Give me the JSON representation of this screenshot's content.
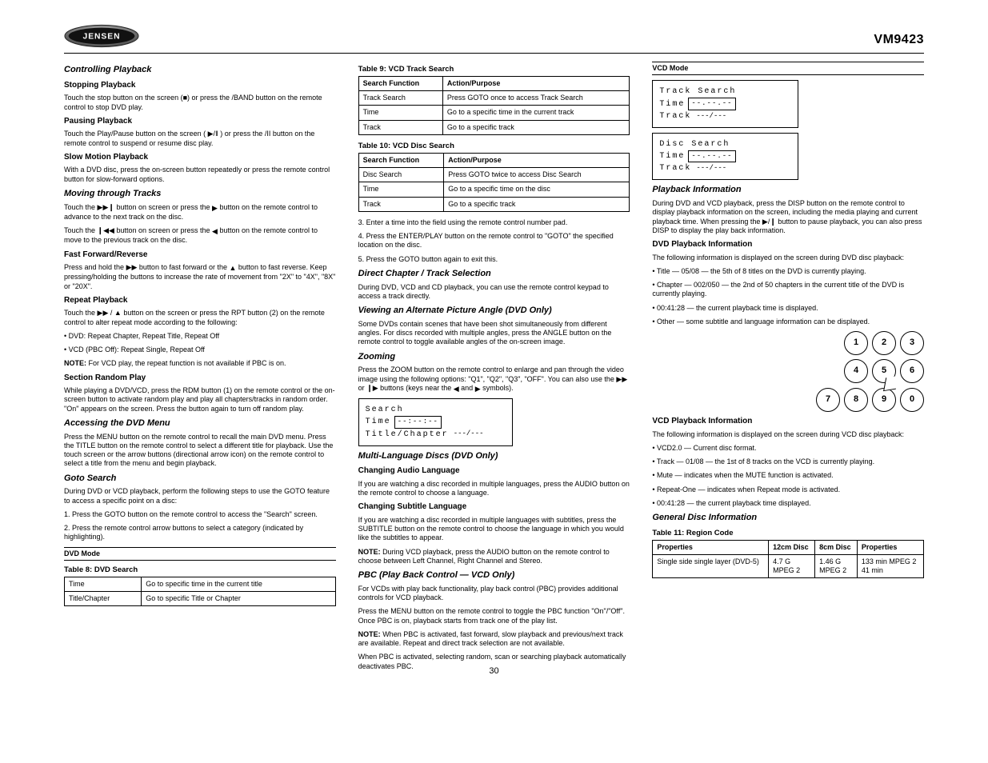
{
  "header": {
    "brand": "JENSEN",
    "model": "VM9423"
  },
  "col1": {
    "h_controlling": "Controlling Playback",
    "h_stopping": "Stopping Playback",
    "p_stopping": "Touch the stop button on the screen (■) or press the /BAND button on the remote control to stop DVD play.",
    "h_pausing": "Pausing Playback",
    "p_pausing_1": "Touch the Play/Pause button on the screen (",
    "p_pausing_2": ") or press the /II button on the remote control to suspend or resume disc play.",
    "h_slow": "Slow Motion Playback",
    "p_slow": "With a DVD disc, press the on-screen button repeatedly or press the remote control button for slow-forward options.",
    "h_moving": "Moving through Tracks",
    "p_moving_1a": "Touch the ",
    "p_moving_1b": " button on screen or press the ",
    "p_moving_1c": " button on the remote control to advance to the next track on the disc.",
    "p_moving_2a": "Touch the ",
    "p_moving_2b": " button on screen or press the ",
    "p_moving_2c": " button on the remote control to move to the previous track on the disc.",
    "h_ffrw": "Fast Forward/Reverse",
    "p_ffrw_a": "Press and hold the ",
    "p_ffrw_b": " button to fast forward or the ",
    "p_ffrw_c": " button to fast reverse. Keep pressing/holding the buttons to increase the rate of movement from \"2X\" to \"4X\", \"8X\" or \"20X\".",
    "h_repeat": "Repeat Playback",
    "p_repeat_a": "Touch the ",
    "p_repeat_b": "/",
    "p_repeat_c": " button on the screen or press the RPT button (2) on the remote control to alter repeat mode according to the following:",
    "list_dvd": "DVD: Repeat Chapter, Repeat Title, Repeat Off",
    "list_vcd": "VCD (PBC Off): Repeat Single, Repeat Off",
    "note_label": "NOTE:",
    "note_text": " For VCD play, the repeat function is not available if PBC is on.",
    "h_random": "Section Random Play",
    "p_random": "While playing a DVD/VCD, press the RDM button (1) on the remote control or the on-screen button to activate random play and play all chapters/tracks in random order. \"On\" appears on the screen. Press the button again to turn off random play.",
    "h_access": "Accessing the DVD Menu",
    "p_access": "Press the MENU button on the remote control to recall the main DVD menu. Press the TITLE button on the remote control to select a different title for playback. Use the touch screen or the arrow buttons (directional arrow icon) on the remote control to select a title from the menu and begin playback.",
    "h_goto": "Goto Search",
    "p_goto": "During DVD or VCD playback, perform the following steps to use the GOTO feature to access a specific point on a disc:",
    "step1": "1. Press the GOTO button on the remote control to access the \"Search\" screen.",
    "step2": "2. Press the remote control arrow buttons to select a category (indicated by highlighting).",
    "lbl_dvd_mode": "DVD Mode",
    "tbl1": {
      "title": "Table 8: DVD Search",
      "rows": [
        [
          "Time",
          "Go to specific time in the current title"
        ],
        [
          "Title/Chapter",
          "Go to specific Title or Chapter"
        ]
      ]
    }
  },
  "col2": {
    "tbl_vcd_track": {
      "title": "Table 9: VCD Track Search",
      "headers": [
        "Search Function",
        "Action/Purpose"
      ],
      "rows": [
        [
          "Track Search",
          "Press GOTO once to access Track Search"
        ],
        [
          "Time",
          "Go to a specific time in the current track"
        ],
        [
          "Track",
          "Go to a specific track"
        ]
      ]
    },
    "tbl_vcd_disc": {
      "title": "Table 10: VCD Disc Search",
      "headers": [
        "Search Function",
        "Action/Purpose"
      ],
      "rows": [
        [
          "Disc Search",
          "Press GOTO twice to access Disc Search"
        ],
        [
          "Time",
          "Go to a specific time on the disc"
        ],
        [
          "Track",
          "Go to a specific track"
        ]
      ]
    },
    "step3": "3. Enter a time into the field using the remote control number pad.",
    "step4": "4. Press the ENTER/PLAY button on the remote control to \"GOTO\" the specified location on the disc.",
    "step5": "5. Press the GOTO button again to exit this.",
    "h_direct": "Direct Chapter / Track Selection",
    "p_direct": "During DVD, VCD and CD playback, you can use the remote control keypad to access a track directly.",
    "h_angle": "Viewing an Alternate Picture Angle (DVD Only)",
    "p_angle1": "Some DVDs contain scenes that have been shot simultaneously from different angles. For discs recorded with multiple angles, press the ANGLE button on the remote control to toggle available angles of the on-screen image.",
    "h_zoom": "Zooming",
    "p_zoom_a": "Press the ZOOM button on the remote control to enlarge and pan through the video image using the following options: \"Q1\", \"Q2\", \"Q3\", \"OFF\". You can also use the ",
    "p_zoom_b": " or ",
    "p_zoom_c": " buttons (keys near the ",
    "p_zoom_d": " and ",
    "p_zoom_e": " symbols).",
    "h_multi": "Multi-Language Discs (DVD Only)",
    "h_audio": "Changing Audio Language",
    "p_audio": "If you are watching a disc recorded in multiple languages, press the AUDIO button on the remote control to choose a language.",
    "h_subtitle": "Changing Subtitle Language",
    "p_subtitle": "If you are watching a disc recorded in multiple languages with subtitles, press the SUBTITLE button on the remote control to choose the language in which you would like the subtitles to appear.",
    "note_label": "NOTE:",
    "note_text": " During VCD playback, press the AUDIO button on the remote control to choose between Left Channel, Right Channel and Stereo.",
    "h_pbc": "PBC (Play Back Control — VCD Only)",
    "p_pbc_intro": "For VCDs with play back functionality, play back control (PBC) provides additional controls for VCD playback.",
    "p_pbc_toggle": "Press the MENU button on the remote control to toggle the PBC function \"On\"/\"Off\". Once PBC is on, playback starts from track one of the play list.",
    "p_pbc_note_label": "NOTE:",
    "p_pbc_note": " When PBC is activated, fast forward, slow playback and previous/next track are available. Repeat and direct track selection are not available.",
    "p_pbc_rdm": "When PBC is activated, selecting random, scan or searching playback automatically deactivates PBC.",
    "h_osd_search": "Search",
    "osd_search": {
      "l1": "Search",
      "l2_label": "Time",
      "l2_field": "--:--:--",
      "l3_label": "Title/Chapter",
      "l3_dash": "---/---"
    }
  },
  "col3": {
    "lbl_vcd_mode": "VCD Mode",
    "osd_track": {
      "title": "Track Search",
      "time_label": "Time",
      "time_field": "--.--.--",
      "track_label": "Track",
      "track_dash": "---/---"
    },
    "osd_disc": {
      "title": "Disc Search",
      "time_label": "Time",
      "time_field": "--.--.--",
      "track_label": "Track",
      "track_dash": "---/---"
    },
    "h_disp": "Playback Information",
    "p_disp_a": "During DVD and VCD playback, press the DISP button on the remote control to display playback information on the screen, including the media playing and current playback time. When pressing the ",
    "p_disp_b": " button to pause playback, you can also press DISP to display the play back information.",
    "h_dvdinfo": "DVD Playback Information",
    "p_dvdinfo_intro": "The following information is displayed on the screen during DVD disc playback:",
    "dvd_items": [
      "Title — 05/08 — the 5th of 8 titles on the DVD is currently playing.",
      "Chapter — 002/050 — the 2nd of 50 chapters in the current title of the DVD is currently playing.",
      "00:41:28 — the current playback time is displayed.",
      "Other — some subtitle and language information can be displayed."
    ],
    "h_vcdinfo": "VCD Playback Information",
    "p_vcdinfo_intro": "The following information is displayed on the screen during VCD disc playback:",
    "vcd_items": [
      "VCD2.0 — Current disc format.",
      "Track — 01/08 — the 1st of 8 tracks on the VCD is currently playing.",
      "Mute — indicates when the MUTE function is activated.",
      "Repeat-One — indicates when Repeat mode is activated.",
      "00:41:28 — the current playback time displayed."
    ],
    "h_region": "General Disc Information",
    "tbl_region": {
      "title": "Table 11: Region Code",
      "headers": [
        "Properties",
        "12cm Disc",
        "8cm Disc",
        "Properties"
      ],
      "rows": [
        [
          "Single side single layer (DVD-5)",
          "MPEG 2",
          "133 min MPEG 2",
          "4.7 G",
          "1.46 G",
          "41 min"
        ]
      ]
    },
    "keypad": [
      "1",
      "2",
      "3",
      "4",
      "5",
      "6",
      "7",
      "8",
      "9",
      "0"
    ]
  },
  "pagenum": "30"
}
